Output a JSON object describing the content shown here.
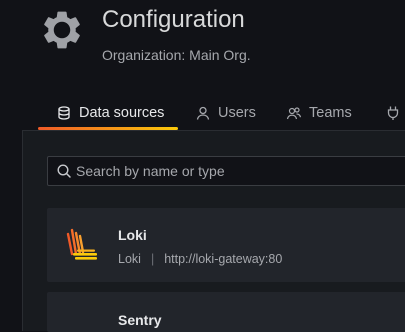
{
  "header": {
    "title": "Configuration",
    "subtitle": "Organization: Main Org.",
    "icon": "gear-icon"
  },
  "tabs": [
    {
      "label": "Data sources",
      "icon": "database-icon",
      "active": true
    },
    {
      "label": "Users",
      "icon": "user-icon",
      "active": false
    },
    {
      "label": "Teams",
      "icon": "users-icon",
      "active": false
    },
    {
      "label": "",
      "icon": "plug-icon",
      "active": false
    }
  ],
  "search": {
    "placeholder": "Search by name or type",
    "value": ""
  },
  "datasources": [
    {
      "name": "Loki",
      "type": "Loki",
      "separator": "|",
      "url": "http://loki-gateway:80",
      "icon": "loki-logo"
    },
    {
      "name": "Sentry",
      "type": "",
      "separator": "",
      "url": "",
      "icon": ""
    }
  ],
  "colors": {
    "background": "#111217",
    "panel": "#181b1f",
    "card": "#22252b",
    "tab_accent_start": "#f05a28",
    "tab_accent_end": "#fbca0a"
  }
}
